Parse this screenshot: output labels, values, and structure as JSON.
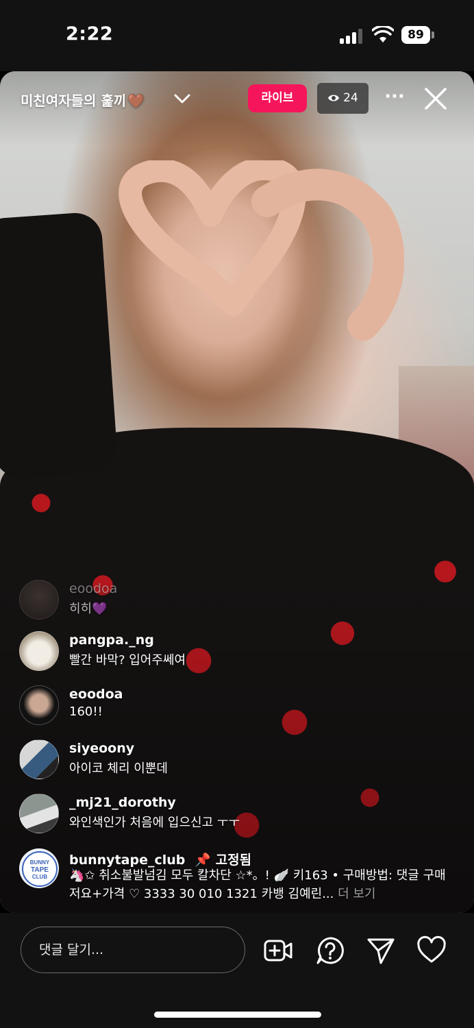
{
  "status_bar": {
    "time": "2:22",
    "battery": "89"
  },
  "live": {
    "title": "미친여자들의 훑끼",
    "title_emoji": "🤎",
    "live_badge": "라이브",
    "viewer_count": "24"
  },
  "comments": [
    {
      "user": "eoodoa",
      "text": "히히💜"
    },
    {
      "user": "pangpa._ng",
      "text": "빨간 바막? 입어주쎄여"
    },
    {
      "user": "eoodoa",
      "text": "160!!"
    },
    {
      "user": "siyeoony",
      "text": "아이코 체리 이뿐데"
    },
    {
      "user": "_mj21_dorothy",
      "text": "와인색인가 처음에 입으신고 ㅜㅜ"
    }
  ],
  "pinned": {
    "user": "bunnytape_club",
    "pin_label": "📌 고정됨",
    "text": "🦄✩ 취소불발넘김 모두 칼차단 ☆*。! 🪽 키163 • 구매방법: 댓글 구매 저요+가격 ♡ 3333 30 010 1321 카뱅 김예린...",
    "more": "더 보기",
    "avatar_text": "BUNNY TAPE CLUB"
  },
  "bottom_bar": {
    "input_placeholder": "댓글 달기..."
  },
  "colors": {
    "live_badge": "#f5155b",
    "status_bg": "#121212"
  },
  "icons": [
    "signal-icon",
    "wifi-icon",
    "battery-icon",
    "chevron-down-icon",
    "eye-icon",
    "more-icon",
    "close-icon",
    "add-video-icon",
    "question-icon",
    "send-icon",
    "heart-icon",
    "pin-icon"
  ]
}
